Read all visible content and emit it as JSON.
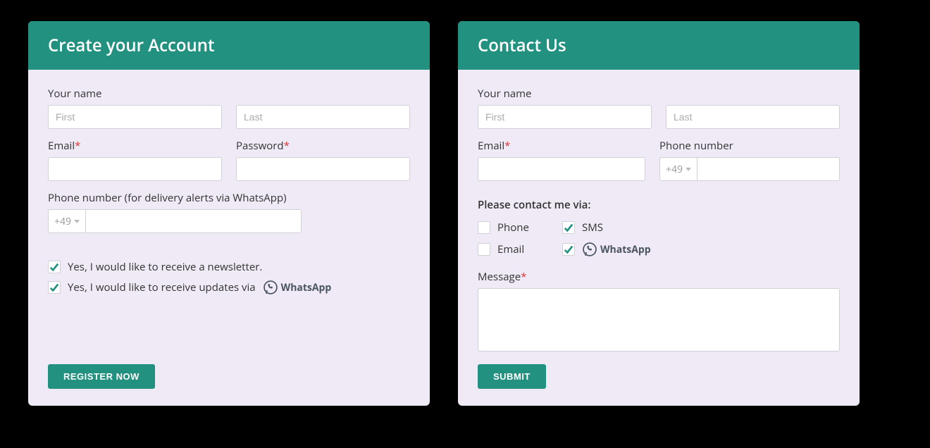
{
  "create": {
    "title": "Create your Account",
    "name_label": "Your name",
    "first_ph": "First",
    "last_ph": "Last",
    "email_label": "Email",
    "password_label": "Password",
    "phone_label": "Phone number (for delivery alerts via WhatsApp)",
    "phone_cc": "+49",
    "check_newsletter": "Yes, I would like to receive a newsletter.",
    "check_updates": "Yes, I would like to receive updates via",
    "whatsapp_text": "WhatsApp",
    "button": "REGISTER NOW"
  },
  "contact": {
    "title": "Contact Us",
    "name_label": "Your name",
    "first_ph": "First",
    "last_ph": "Last",
    "email_label": "Email",
    "phone_label": "Phone number",
    "phone_cc": "+49",
    "contact_pref_label": "Please contact me via:",
    "opt_phone": "Phone",
    "opt_sms": "SMS",
    "opt_email": "Email",
    "whatsapp_text": "WhatsApp",
    "message_label": "Message",
    "button": "SUBMIT"
  }
}
